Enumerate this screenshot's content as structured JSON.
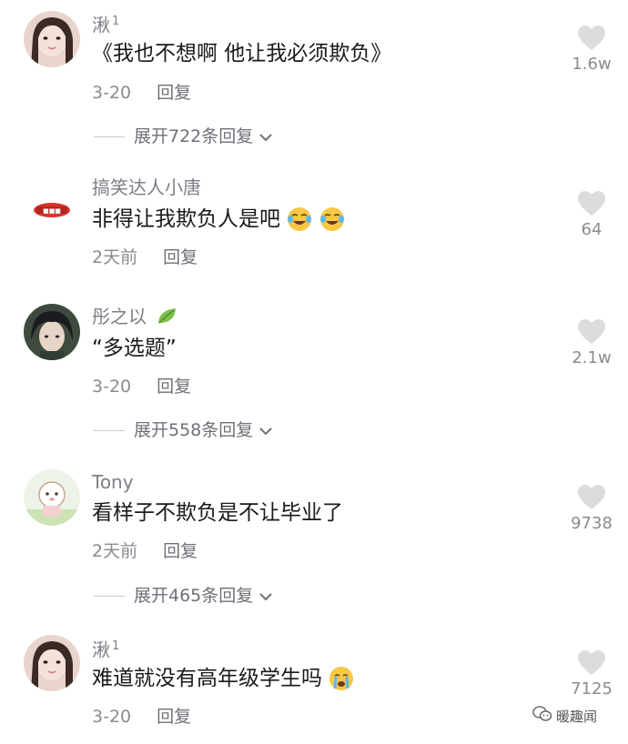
{
  "comments": [
    {
      "username": "湫",
      "badge": "1",
      "text": "《我也不想啊 他让我必须欺负》",
      "time": "3-20",
      "reply_label": "回复",
      "expand_label": "展开722条回复",
      "likes": "1.6w"
    },
    {
      "username": "搞笑达人小唐",
      "badge": "",
      "text": "非得让我欺负人是吧",
      "emojis": [
        "laugh-cry-emoji",
        "laugh-cry-emoji"
      ],
      "time": "2天前",
      "reply_label": "回复",
      "likes": "64"
    },
    {
      "username": "彤之以",
      "badge": "",
      "text": "“多选题”",
      "time": "3-20",
      "reply_label": "回复",
      "expand_label": "展开558条回复",
      "likes": "2.1w"
    },
    {
      "username": "Tony",
      "badge": "",
      "text": "看样子不欺负是不让毕业了",
      "time": "2天前",
      "reply_label": "回复",
      "expand_label": "展开465条回复",
      "likes": "9738"
    },
    {
      "username": "湫",
      "badge": "1",
      "text": "难道就没有高年级学生吗",
      "emojis": [
        "crying-emoji"
      ],
      "time": "3-20",
      "reply_label": "回复",
      "likes": "7125"
    }
  ],
  "watermark": {
    "label": "暖趣闻",
    "icon": "wechat-icon"
  },
  "colors": {
    "username": "#7d7e86",
    "text": "#1a1a1a",
    "meta": "#8a8b91",
    "heart": "#dcdcdf"
  }
}
